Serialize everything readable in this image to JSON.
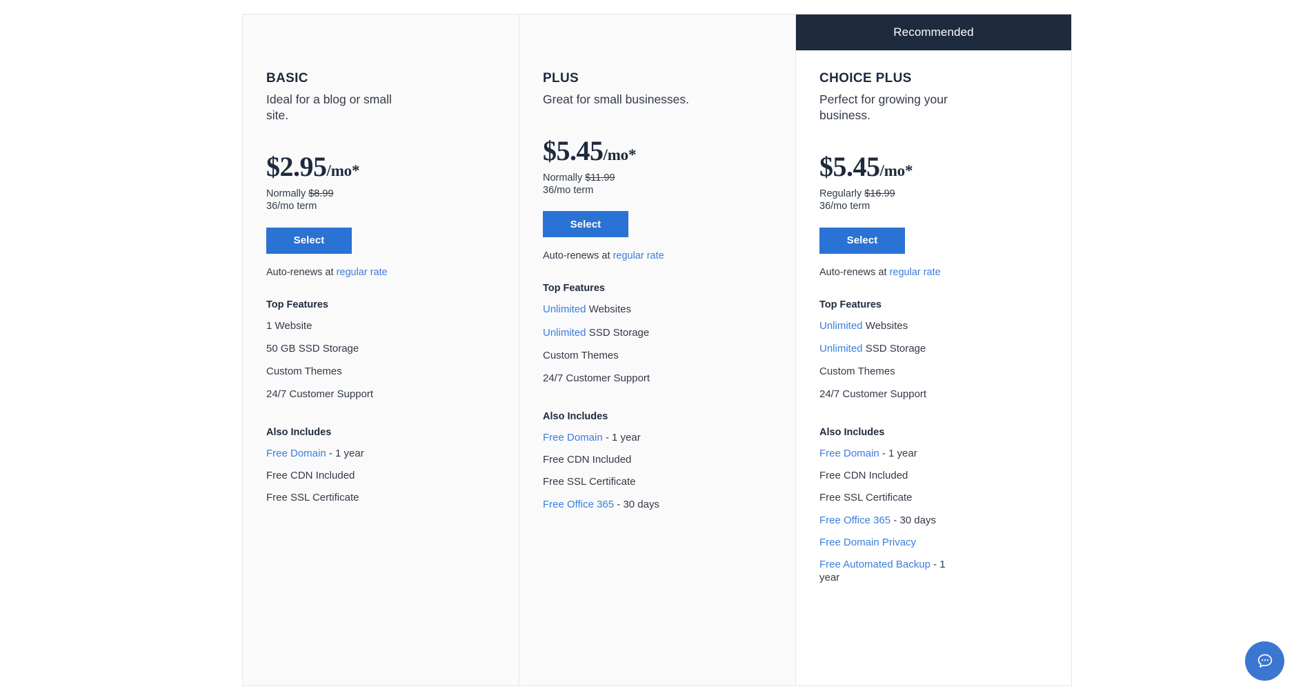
{
  "plans": [
    {
      "recommended_label": null,
      "name": "BASIC",
      "tagline": "Ideal for a blog or small site.",
      "price_main": "$2.95",
      "price_suffix": "/mo*",
      "normally_prefix": "Normally",
      "normally_price": "$8.99",
      "term": "36/mo term",
      "select_label": "Select",
      "renew_prefix": "Auto-renews at",
      "renew_link": "regular rate",
      "top_features_title": "Top Features",
      "top_features": [
        {
          "link": "",
          "text": "1 Website"
        },
        {
          "link": "",
          "text": "50 GB SSD Storage"
        },
        {
          "link": "",
          "text": "Custom Themes"
        },
        {
          "link": "",
          "text": "24/7 Customer Support"
        }
      ],
      "also_includes_title": "Also Includes",
      "also_includes": [
        {
          "link": "Free Domain",
          "text": " - 1 year"
        },
        {
          "link": "",
          "text": "Free CDN Included"
        },
        {
          "link": "",
          "text": "Free SSL Certificate"
        }
      ]
    },
    {
      "recommended_label": null,
      "name": "PLUS",
      "tagline": "Great for small businesses.",
      "price_main": "$5.45",
      "price_suffix": "/mo*",
      "normally_prefix": "Normally",
      "normally_price": "$11.99",
      "term": "36/mo term",
      "select_label": "Select",
      "renew_prefix": "Auto-renews at",
      "renew_link": "regular rate",
      "top_features_title": "Top Features",
      "top_features": [
        {
          "link": "Unlimited",
          "text": " Websites"
        },
        {
          "link": "Unlimited",
          "text": " SSD Storage"
        },
        {
          "link": "",
          "text": "Custom Themes"
        },
        {
          "link": "",
          "text": "24/7 Customer Support"
        }
      ],
      "also_includes_title": "Also Includes",
      "also_includes": [
        {
          "link": "Free Domain",
          "text": " - 1 year"
        },
        {
          "link": "",
          "text": "Free CDN Included"
        },
        {
          "link": "",
          "text": "Free SSL Certificate"
        },
        {
          "link": "Free Office 365",
          "text": " - 30 days"
        }
      ]
    },
    {
      "recommended_label": "Recommended",
      "name": "CHOICE PLUS",
      "tagline": "Perfect for growing your business.",
      "price_main": "$5.45",
      "price_suffix": "/mo*",
      "normally_prefix": "Regularly",
      "normally_price": "$16.99",
      "term": "36/mo term",
      "select_label": "Select",
      "renew_prefix": "Auto-renews at",
      "renew_link": "regular rate",
      "top_features_title": "Top Features",
      "top_features": [
        {
          "link": "Unlimited",
          "text": " Websites"
        },
        {
          "link": "Unlimited",
          "text": " SSD Storage"
        },
        {
          "link": "",
          "text": "Custom Themes"
        },
        {
          "link": "",
          "text": "24/7 Customer Support"
        }
      ],
      "also_includes_title": "Also Includes",
      "also_includes": [
        {
          "link": "Free Domain",
          "text": " - 1 year"
        },
        {
          "link": "",
          "text": "Free CDN Included"
        },
        {
          "link": "",
          "text": "Free SSL Certificate"
        },
        {
          "link": "Free Office 365",
          "text": " - 30 days"
        },
        {
          "link": "Free Domain Privacy",
          "text": ""
        },
        {
          "link": "Free Automated Backup",
          "text": " - 1 year"
        }
      ]
    }
  ],
  "chat": {
    "icon": "chat-bubble-icon"
  },
  "colors": {
    "accent_blue": "#2a72d4",
    "link_blue": "#3b7ddd",
    "banner_navy": "#1e2a3d",
    "card_bg": "#fafafa",
    "featured_bg": "#ffffff"
  }
}
